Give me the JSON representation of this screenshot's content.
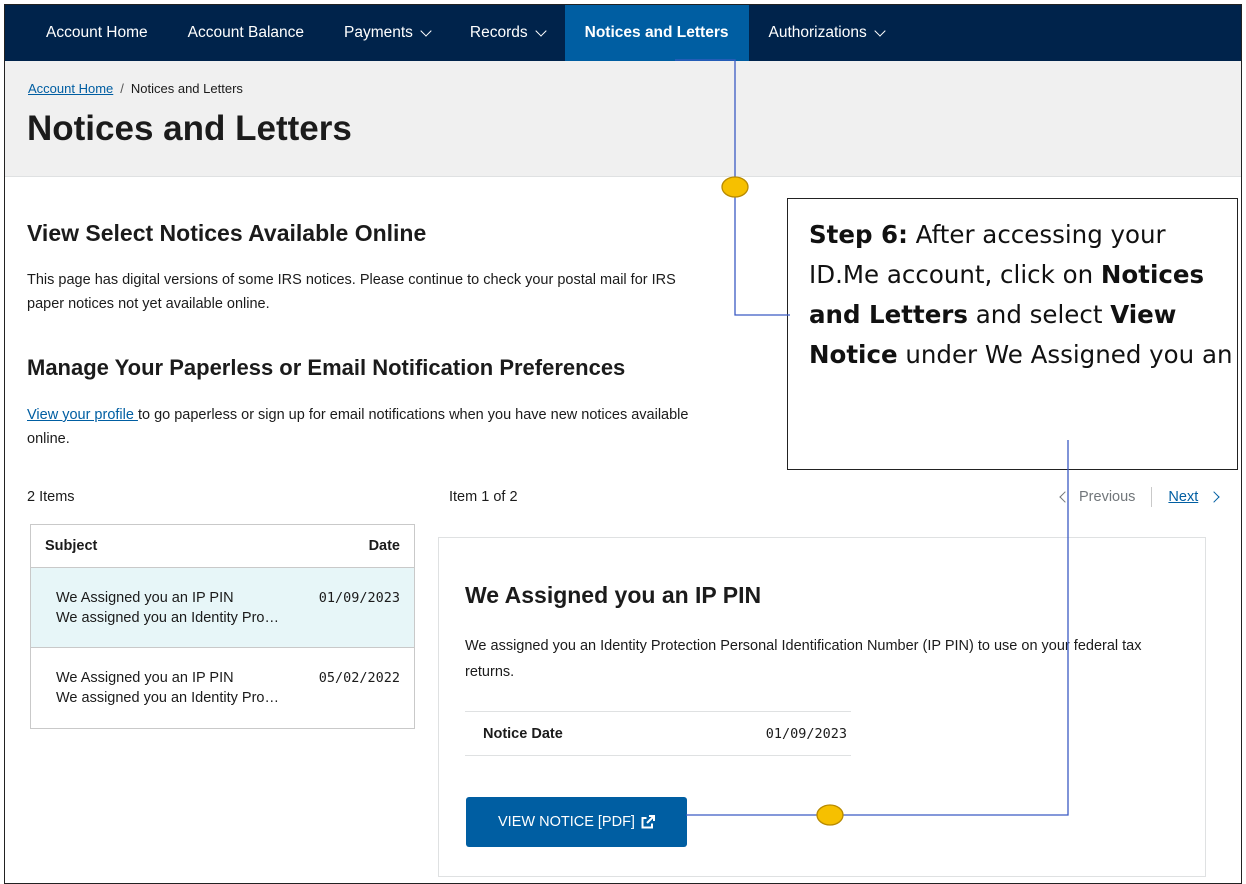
{
  "nav": {
    "items": [
      {
        "label": "Account Home",
        "dropdown": false,
        "active": false
      },
      {
        "label": "Account Balance",
        "dropdown": false,
        "active": false
      },
      {
        "label": "Payments",
        "dropdown": true,
        "active": false
      },
      {
        "label": "Records",
        "dropdown": true,
        "active": false
      },
      {
        "label": "Notices and Letters",
        "dropdown": false,
        "active": true
      },
      {
        "label": "Authorizations",
        "dropdown": true,
        "active": false
      }
    ]
  },
  "breadcrumb": {
    "home": "Account Home",
    "separator": "/",
    "current": "Notices and Letters"
  },
  "page_title": "Notices and Letters",
  "section1": {
    "heading": "View Select Notices Available Online",
    "text": "This page has digital versions of some IRS notices. Please continue to check your postal mail for IRS paper notices not yet available online."
  },
  "section2": {
    "heading": "Manage Your Paperless or Email Notification Preferences",
    "link": "View your profile ",
    "text": "to go paperless or sign up for email notifications when you have new notices available online."
  },
  "list": {
    "count": "2 Items",
    "col_subject": "Subject",
    "col_date": "Date",
    "rows": [
      {
        "subject": "We Assigned you an IP PIN",
        "date": "01/09/2023",
        "preview": "We assigned you an Identity Pro…"
      },
      {
        "subject": "We Assigned you an IP PIN",
        "date": "05/02/2022",
        "preview": "We assigned you an Identity Pro…"
      }
    ]
  },
  "pager": {
    "position": "Item 1 of 2",
    "previous": "Previous",
    "next": "Next"
  },
  "detail": {
    "title": "We Assigned you an IP PIN",
    "description": "We assigned you an Identity Protection Personal Identification Number (IP PIN) to use on your federal tax returns.",
    "notice_date_label": "Notice Date",
    "notice_date": "01/09/2023",
    "button": "VIEW NOTICE [PDF]"
  },
  "callout": {
    "step": "Step 6:",
    "t1": " After accessing your ID.Me account, click on ",
    "b1": "Notices and Letters",
    "t2": " and select ",
    "b2": "View Notice",
    "t3": " under We Assigned you an"
  },
  "colors": {
    "nav_bg": "#00234b",
    "active_tab": "#005ea2",
    "button": "#005ea2",
    "link": "#005ea2",
    "selected_row": "#e7f6f8",
    "marker": "#f6c000",
    "connector": "#3b5bc4"
  }
}
